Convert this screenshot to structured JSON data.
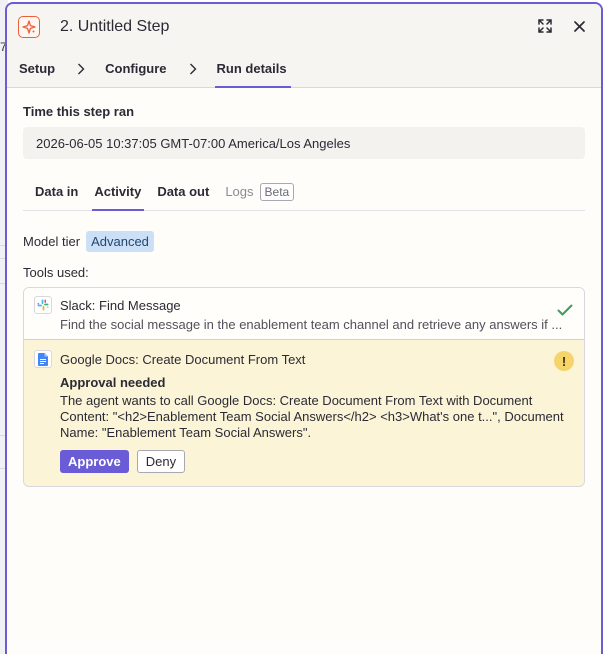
{
  "background": {
    "edge_digit": "7"
  },
  "header": {
    "title": "2. Untitled Step",
    "icons": {
      "app": "sparkle-icon",
      "expand": "expand-icon",
      "close": "close-icon"
    }
  },
  "steps": {
    "items": [
      "Setup",
      "Configure",
      "Run details"
    ],
    "active": "Run details"
  },
  "run": {
    "time_label": "Time this step ran",
    "time_value": "2026-06-05 10:37:05 GMT-07:00 America/Los Angeles"
  },
  "tabs": {
    "data_in": "Data in",
    "activity": "Activity",
    "data_out": "Data out",
    "logs": "Logs",
    "beta": "Beta",
    "active": "Activity"
  },
  "model": {
    "label": "Model tier",
    "tier": "Advanced"
  },
  "tools": {
    "label": "Tools used:",
    "items": [
      {
        "name": "Slack: Find Message",
        "description": "Find the social message in the enablement team channel and retrieve any answers if ...",
        "icon": "slack-icon",
        "status": "success"
      },
      {
        "name": "Google Docs: Create Document From Text",
        "icon": "google-docs-icon",
        "status": "approval-needed",
        "approval_title": "Approval needed",
        "approval_text": "The agent wants to call Google Docs: Create Document From Text with Document Content: \"<h2>Enablement Team Social Answers</h2> <h3>What's one t...\", Document Name: \"Enablement Team Social Answers\".",
        "approve_label": "Approve",
        "deny_label": "Deny"
      }
    ]
  },
  "colors": {
    "accent": "#6a5cd6",
    "warning_bg": "#fbf4d6",
    "warning_icon": "#f5d46b",
    "success": "#3e9b5a",
    "pill_bg": "#cbe0f7"
  }
}
